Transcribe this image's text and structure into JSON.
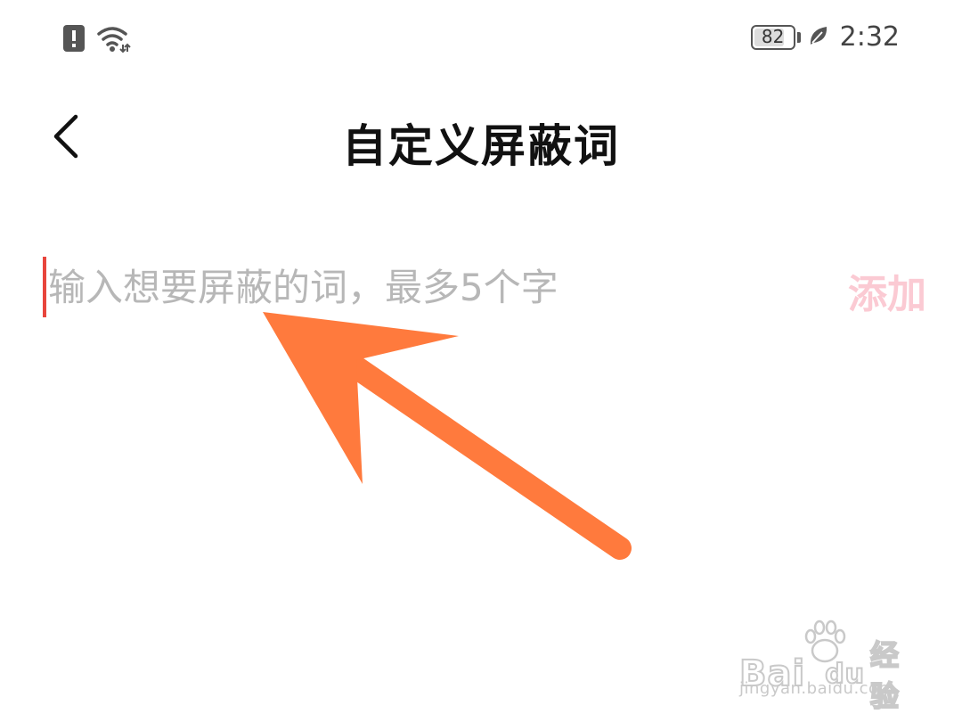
{
  "status_bar": {
    "icons": [
      "notification-alert-icon",
      "wifi-icon",
      "leaf-icon"
    ],
    "battery_level": "82",
    "battery_fraction": 0.82,
    "time": "2:32"
  },
  "header": {
    "back_icon": "chevron-left-icon",
    "title": "自定义屏蔽词"
  },
  "input": {
    "value": "",
    "placeholder": "输入想要屏蔽的词，最多5个字"
  },
  "add_button": {
    "label": "添加",
    "color": "#fbcad3"
  },
  "annotation": {
    "icon": "arrow-annotation",
    "color": "#ff7a3d"
  },
  "watermark": {
    "logo_text": "Bai",
    "logo_paw_text": "du",
    "logo_cn": "经验",
    "url": "jingyan.baidu.com"
  },
  "colors": {
    "accent": "#e8453c",
    "placeholder": "#b7b7b7"
  }
}
